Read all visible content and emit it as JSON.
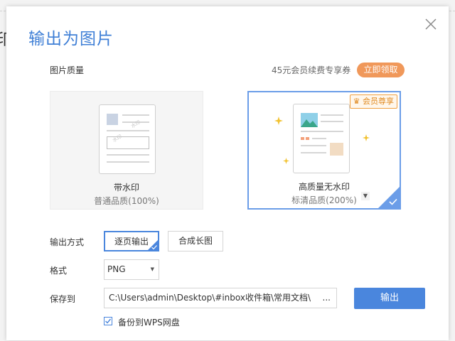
{
  "background": {
    "partial_char": "印"
  },
  "dialog": {
    "title": "输出为图片",
    "close_icon": "close-icon"
  },
  "quality": {
    "label": "图片质量",
    "promo_text": "45元会员续费专享券",
    "promo_button": "立即领取",
    "options": [
      {
        "title": "带水印",
        "subtitle": "普通品质(100%)",
        "selected": false
      },
      {
        "title": "高质量无水印",
        "subtitle": "标清品质(200%)",
        "selected": true,
        "badge": "会员尊享"
      }
    ]
  },
  "output_mode": {
    "label": "输出方式",
    "options": [
      {
        "label": "逐页输出",
        "selected": true
      },
      {
        "label": "合成长图",
        "selected": false
      }
    ]
  },
  "format": {
    "label": "格式",
    "value": "PNG"
  },
  "save": {
    "label": "保存到",
    "path": "C:\\Users\\admin\\Desktop\\#inbox收件箱\\常用文档\\",
    "browse": "..."
  },
  "export_button": "输出",
  "backup": {
    "label": "备份到WPS网盘",
    "checked": true
  },
  "colors": {
    "accent": "#4a86dd",
    "title": "#3f7fd6",
    "promo": "#f0985a",
    "badge": "#e08a20"
  }
}
